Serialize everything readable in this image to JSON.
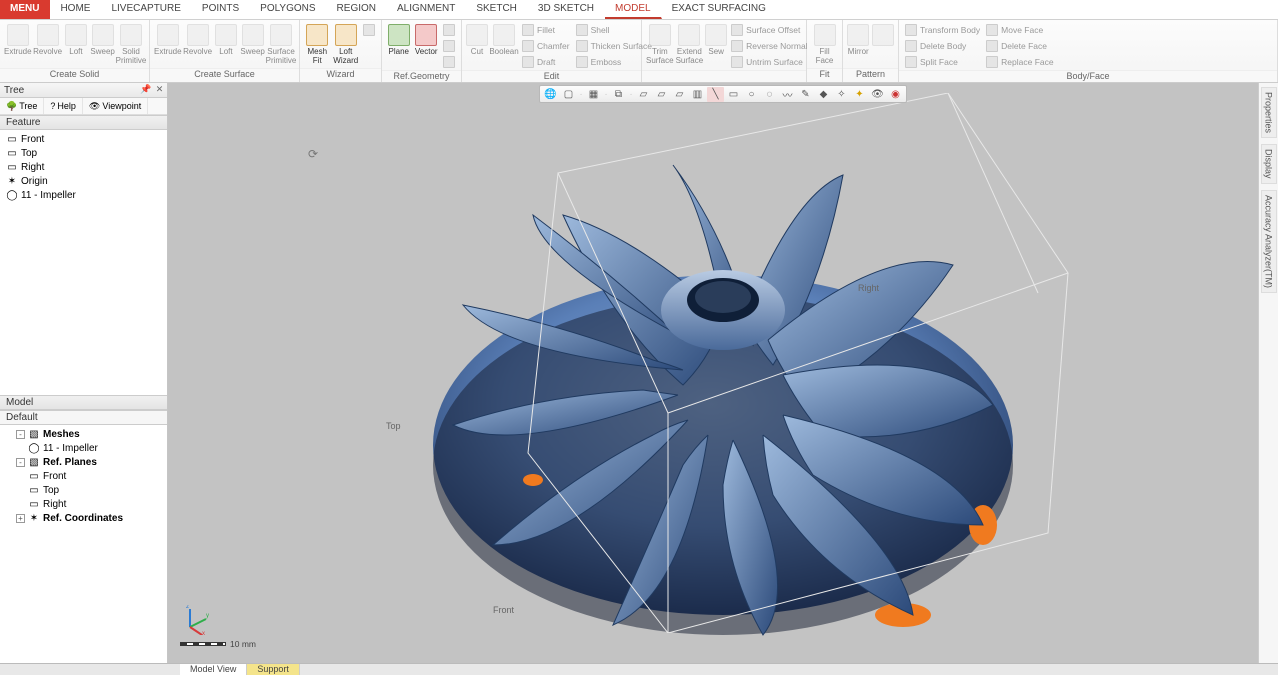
{
  "tabs": {
    "menu": "MENU",
    "items": [
      "HOME",
      "LIVECAPTURE",
      "POINTS",
      "POLYGONS",
      "REGION",
      "ALIGNMENT",
      "SKETCH",
      "3D SKETCH",
      "MODEL",
      "EXACT SURFACING"
    ],
    "active": "MODEL"
  },
  "ribbon": {
    "groups": [
      {
        "label": "Create Solid",
        "buttons": [
          {
            "label": "Extrude"
          },
          {
            "label": "Revolve"
          },
          {
            "label": "Loft"
          },
          {
            "label": "Sweep"
          },
          {
            "label": "Solid\nPrimitive"
          }
        ]
      },
      {
        "label": "Create Surface",
        "buttons": [
          {
            "label": "Extrude"
          },
          {
            "label": "Revolve"
          },
          {
            "label": "Loft"
          },
          {
            "label": "Sweep"
          },
          {
            "label": "Surface\nPrimitive"
          }
        ]
      },
      {
        "label": "Wizard",
        "buttons": [
          {
            "label": "Mesh\nFit",
            "enabled": true
          },
          {
            "label": "Loft\nWizard",
            "enabled": true
          }
        ],
        "extras": [
          ""
        ]
      },
      {
        "label": "Ref.Geometry",
        "buttons": [
          {
            "label": "Plane",
            "enabled": true
          },
          {
            "label": "Vector",
            "enabled": true
          }
        ],
        "extras": [
          "",
          "",
          ""
        ]
      },
      {
        "label": "Edit",
        "buttons": [
          {
            "label": "Cut"
          },
          {
            "label": "Boolean"
          }
        ],
        "rows": [
          [
            "Fillet",
            "Shell"
          ],
          [
            "Chamfer",
            "Thicken Surface"
          ],
          [
            "Draft",
            "Emboss"
          ]
        ]
      },
      {
        "label": "",
        "buttons": [
          {
            "label": "Trim\nSurface"
          },
          {
            "label": "Extend\nSurface"
          },
          {
            "label": "Sew"
          }
        ],
        "rows": [
          [
            "Surface Offset"
          ],
          [
            "Reverse Normal"
          ],
          [
            "Untrim Surface"
          ]
        ]
      },
      {
        "label": "Fit",
        "buttons": [
          {
            "label": "Fill\nFace"
          }
        ]
      },
      {
        "label": "Pattern",
        "buttons": [
          {
            "label": "Mirror"
          },
          {
            "label": ""
          }
        ]
      },
      {
        "label": "Body/Face",
        "rows": [
          [
            "Transform Body",
            "Move Face"
          ],
          [
            "Delete Body",
            "Delete Face"
          ],
          [
            "Split Face",
            "Replace Face"
          ]
        ]
      }
    ]
  },
  "tree": {
    "header": "Tree",
    "tabs": [
      "Tree",
      "Help",
      "Viewpoint"
    ],
    "feature_label": "Feature",
    "features": [
      "Front",
      "Top",
      "Right",
      "Origin",
      "11 - Impeller"
    ],
    "model_label": "Model",
    "default_label": "Default",
    "model_items": {
      "meshes": "Meshes",
      "mesh_item": "11 - Impeller",
      "ref_planes": "Ref. Planes",
      "planes": [
        "Front",
        "Top",
        "Right"
      ],
      "ref_coords": "Ref. Coordinates"
    }
  },
  "viewport": {
    "labels": {
      "top": "Top",
      "front": "Front",
      "right": "Right"
    },
    "scale": "10 mm"
  },
  "bottom_tabs": [
    "Model View",
    "Support"
  ],
  "right_rail": [
    "Properties",
    "Display",
    "Accuracy Analyzer(TM)"
  ]
}
